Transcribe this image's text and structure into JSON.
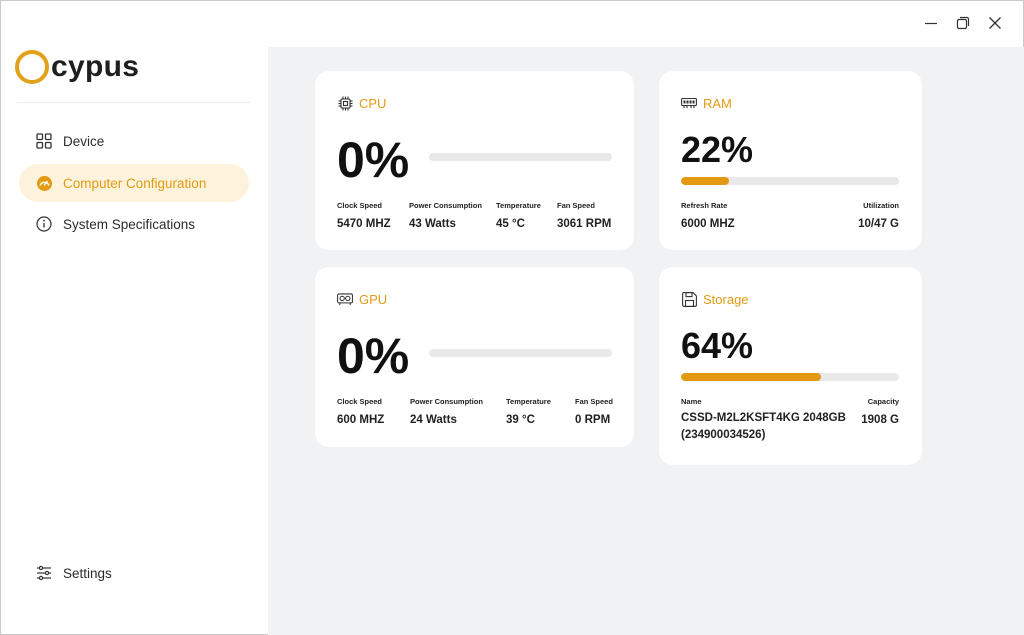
{
  "app": {
    "name": "cypus"
  },
  "window": {
    "minimize_icon": "minimize-icon",
    "maximize_icon": "restore-icon",
    "close_icon": "close-icon"
  },
  "sidebar": {
    "items": [
      {
        "label": "Device",
        "icon": "grid-icon",
        "active": false
      },
      {
        "label": "Computer Configuration",
        "icon": "gauge-icon",
        "active": true
      },
      {
        "label": "System Specifications",
        "icon": "info-icon",
        "active": false
      }
    ],
    "settings": {
      "label": "Settings",
      "icon": "sliders-icon"
    }
  },
  "colors": {
    "accent": "#e39a12",
    "accent_bg": "#fdf3dc",
    "main_bg": "#f1f2f4"
  },
  "cards": {
    "cpu": {
      "title": "CPU",
      "icon": "cpu-chip-icon",
      "percent_text": "0%",
      "usage": 0,
      "stats": [
        {
          "label": "Clock Speed",
          "value": "5470 MHZ"
        },
        {
          "label": "Power Consumption",
          "value": "43 Watts"
        },
        {
          "label": "Temperature",
          "value": "45 °C"
        },
        {
          "label": "Fan Speed",
          "value": "3061 RPM"
        }
      ]
    },
    "ram": {
      "title": "RAM",
      "icon": "memory-icon",
      "percent_text": "22%",
      "usage": 22,
      "stats": [
        {
          "label": "Refresh Rate",
          "value": "6000 MHZ"
        },
        {
          "label": "Utilization",
          "value": "10/47 G"
        }
      ]
    },
    "gpu": {
      "title": "GPU",
      "icon": "gpu-icon",
      "percent_text": "0%",
      "usage": 0,
      "stats": [
        {
          "label": "Clock Speed",
          "value": "600 MHZ"
        },
        {
          "label": "Power Consumption",
          "value": "24 Watts"
        },
        {
          "label": "Temperature",
          "value": "39 °C"
        },
        {
          "label": "Fan Speed",
          "value": "0 RPM"
        }
      ]
    },
    "storage": {
      "title": "Storage",
      "icon": "floppy-disk-icon",
      "percent_text": "64%",
      "usage": 64,
      "stats": [
        {
          "label": "Name",
          "value": "CSSD-M2L2KSFT4KG 2048GB (234900034526)"
        },
        {
          "label": "Capacity",
          "value": "1908 G"
        }
      ]
    }
  }
}
